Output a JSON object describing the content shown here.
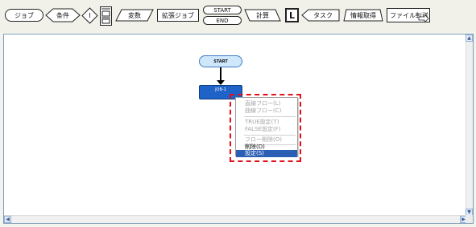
{
  "toolbar": {
    "job": "ジョブ",
    "condition": "条件",
    "loop": "I",
    "wait": "",
    "variable": "変数",
    "extended_job": "拡張ジョブ",
    "start": "START",
    "end": "END",
    "calculation": "計算",
    "label": "L",
    "task": "タスク",
    "info_get": "情報取得",
    "file_transfer": "ファイル転送"
  },
  "flow": {
    "start_node": "START",
    "job_node": "JOB-1"
  },
  "context_menu": {
    "items": [
      {
        "label": "直線フロー(L)",
        "state": "disabled"
      },
      {
        "label": "曲線フロー(C)",
        "state": "disabled"
      },
      {
        "label": "TRUE設定(T)",
        "state": "disabled"
      },
      {
        "label": "FALSE設定(F)",
        "state": "disabled"
      },
      {
        "label": "フロー削除(O)",
        "state": "disabled"
      },
      {
        "label": "削除(D)",
        "state": "enabled"
      },
      {
        "label": "設定(S)",
        "state": "selected"
      }
    ]
  },
  "colors": {
    "highlight_border": "#e0101a",
    "job_node": "#1f63c9",
    "start_node": "#cfe7fb",
    "menu_selected": "#2b5fb5"
  }
}
